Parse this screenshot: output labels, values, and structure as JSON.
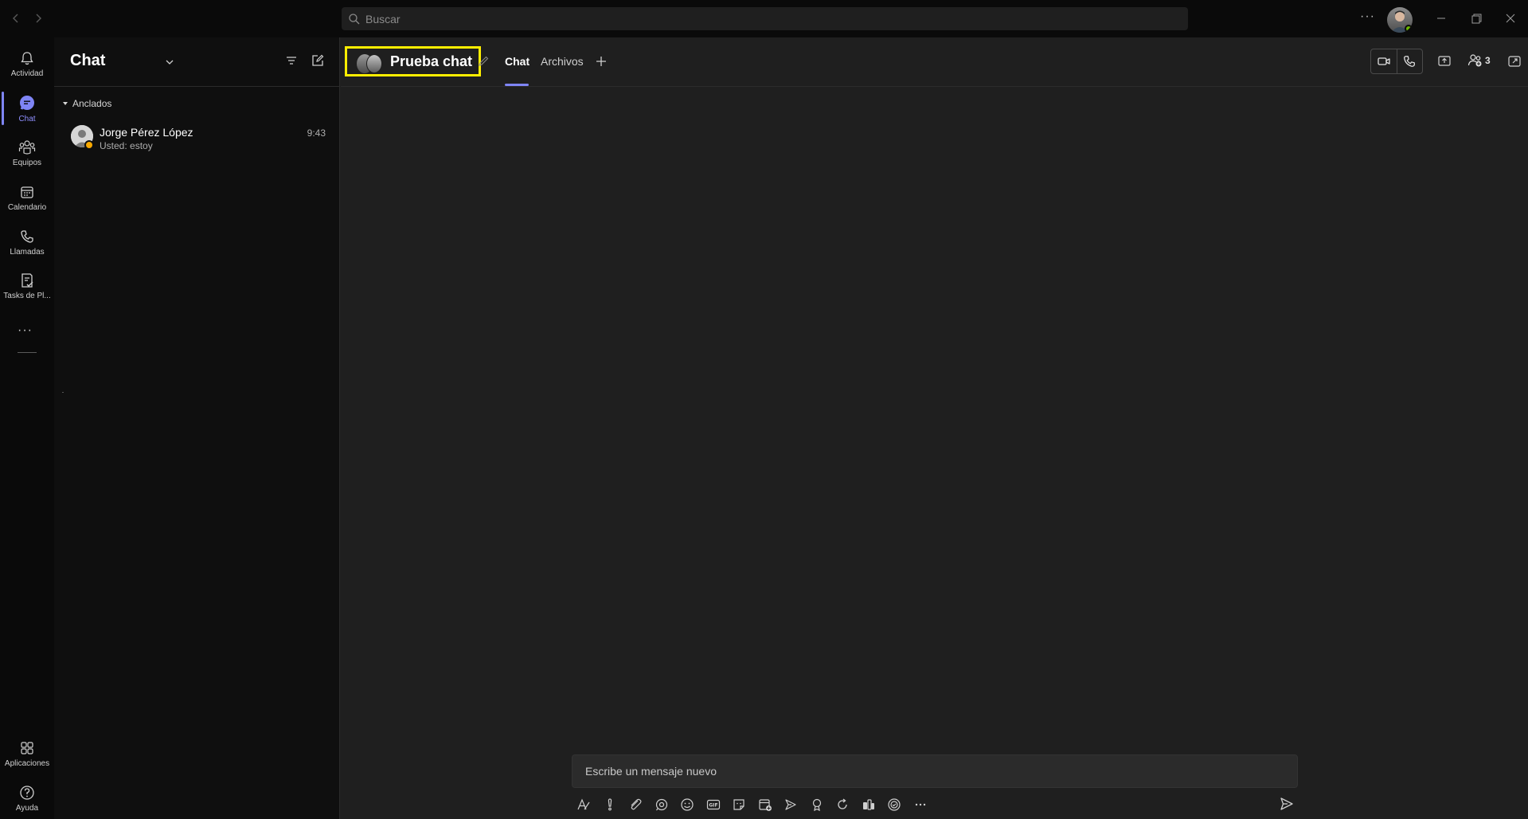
{
  "titlebar": {
    "search_placeholder": "Buscar",
    "more": "···"
  },
  "rail": {
    "items": [
      {
        "label": "Actividad",
        "icon": "bell-icon"
      },
      {
        "label": "Chat",
        "icon": "chat-icon",
        "active": true
      },
      {
        "label": "Equipos",
        "icon": "teams-icon"
      },
      {
        "label": "Calendario",
        "icon": "calendar-icon"
      },
      {
        "label": "Llamadas",
        "icon": "phone-icon"
      },
      {
        "label": "Tasks de Pl...",
        "icon": "tasks-icon"
      }
    ],
    "more": "···",
    "bottom": [
      {
        "label": "Aplicaciones",
        "icon": "apps-icon"
      },
      {
        "label": "Ayuda",
        "icon": "help-icon"
      }
    ]
  },
  "list": {
    "title": "Chat",
    "pinned_label": "Anclados",
    "chats": [
      {
        "name": "Jorge Pérez López",
        "preview": "Usted: estoy",
        "time": "9:43",
        "status_color": "#f8a800"
      }
    ]
  },
  "conversation": {
    "title": "Prueba chat",
    "tabs": [
      {
        "label": "Chat",
        "active": true
      },
      {
        "label": "Archivos",
        "active": false
      }
    ],
    "participant_count": "3",
    "compose_placeholder": "Escribe un mensaje nuevo"
  },
  "colors": {
    "accent": "#7f85f5",
    "highlight_box": "#ffee00",
    "presence_available": "#6bb700",
    "presence_away": "#f8a800"
  }
}
